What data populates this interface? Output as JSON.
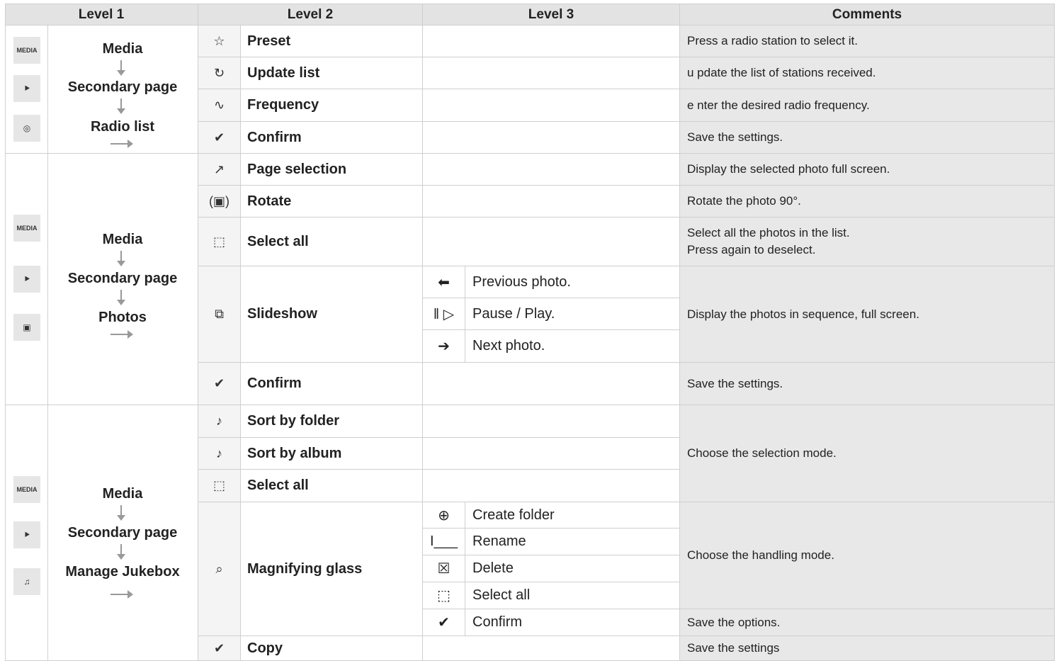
{
  "headers": [
    "Level 1",
    "Level 2",
    "Level 3",
    "Comments"
  ],
  "sections": [
    {
      "level1_icons": [
        {
          "name": "media-icon",
          "text": "MEDIA"
        },
        {
          "name": "secondary-page-icon",
          "text": "⯈"
        },
        {
          "name": "radio-icon",
          "text": "◎"
        }
      ],
      "path": [
        "Media",
        "Secondary page",
        "Radio list"
      ]
    },
    {
      "level1_icons": [
        {
          "name": "media-icon",
          "text": "MEDIA"
        },
        {
          "name": "secondary-page-icon",
          "text": "⯈"
        },
        {
          "name": "photos-icon",
          "text": "▣"
        }
      ],
      "path": [
        "Media",
        "Secondary page",
        "Photos"
      ]
    },
    {
      "level1_icons": [
        {
          "name": "media-icon",
          "text": "MEDIA"
        },
        {
          "name": "secondary-page-icon",
          "text": "⯈"
        },
        {
          "name": "jukebox-icon",
          "text": "♫"
        }
      ],
      "path": [
        "Media",
        "Secondary page",
        "Manage Jukebox"
      ]
    }
  ],
  "level2_rows": [
    {
      "name": "preset",
      "icon": "preset-icon",
      "glyph": "☆",
      "label": "Preset"
    },
    {
      "name": "update-list",
      "icon": "refresh-icon",
      "glyph": "↻",
      "label": "Update list"
    },
    {
      "name": "frequency",
      "icon": "frequency-icon",
      "glyph": "∿",
      "label": "Frequency"
    },
    {
      "name": "confirm",
      "icon": "check-icon",
      "glyph": "✔",
      "label": "Confirm"
    },
    {
      "name": "page-selection",
      "icon": "page-selection-icon",
      "glyph": "↗",
      "label": "Page selection"
    },
    {
      "name": "rotate",
      "icon": "rotate-icon",
      "glyph": "(▣)",
      "label": "Rotate"
    },
    {
      "name": "select-all",
      "icon": "select-all-icon",
      "glyph": "⬚",
      "label": "Select all"
    },
    {
      "name": "slideshow",
      "icon": "slideshow-icon",
      "glyph": "⧉",
      "label": "Slideshow"
    },
    {
      "name": "confirm",
      "icon": "check-icon",
      "glyph": "✔",
      "label": "Confirm"
    },
    {
      "name": "sort-by-folder",
      "icon": "folder-icon",
      "glyph": "♪",
      "label": "Sort by folder"
    },
    {
      "name": "sort-by-album",
      "icon": "album-icon",
      "glyph": "♪",
      "label": "Sort by album"
    },
    {
      "name": "select-all",
      "icon": "select-all-icon",
      "glyph": "⬚",
      "label": "Select all"
    },
    {
      "name": "magnifying-glass",
      "icon": "magnifying-glass-icon",
      "glyph": "⌕",
      "label": "Magnifying glass"
    },
    {
      "name": "copy",
      "icon": "check-icon",
      "glyph": "✔",
      "label": "Copy"
    }
  ],
  "level3_rows": [
    {
      "icon": "arrow-left-icon",
      "glyph": "⬅",
      "label": "Previous photo."
    },
    {
      "icon": "pause-play-icon",
      "glyph": "‖ ▷",
      "label": "Pause / Play."
    },
    {
      "icon": "arrow-right-icon",
      "glyph": "➔",
      "label": "Next photo."
    },
    {
      "icon": "create-folder-icon",
      "glyph": "⊕",
      "label": "Create folder"
    },
    {
      "icon": "rename-icon",
      "glyph": "I___",
      "label": "Rename"
    },
    {
      "icon": "delete-icon",
      "glyph": "☒",
      "label": "Delete"
    },
    {
      "icon": "select-all-icon",
      "glyph": "⬚",
      "label": "Select all"
    },
    {
      "icon": "check-icon",
      "glyph": "✔",
      "label": "Confirm"
    }
  ],
  "comments": [
    [
      "Press a radio station to select it."
    ],
    [
      "u pdate the list of stations received."
    ],
    [
      "e nter the desired radio frequency."
    ],
    [
      "Save the settings."
    ],
    [
      "Display the selected photo full screen."
    ],
    [
      "Rotate the photo 90°."
    ],
    [
      "Select all the photos in the list.",
      "Press again to deselect."
    ],
    [
      "Display the photos in sequence, full screen."
    ],
    [
      "Save the settings."
    ],
    [
      "Choose the selection mode."
    ],
    [
      "Choose the handling mode."
    ],
    [
      "Save the options."
    ],
    [
      "Save the settings"
    ]
  ]
}
